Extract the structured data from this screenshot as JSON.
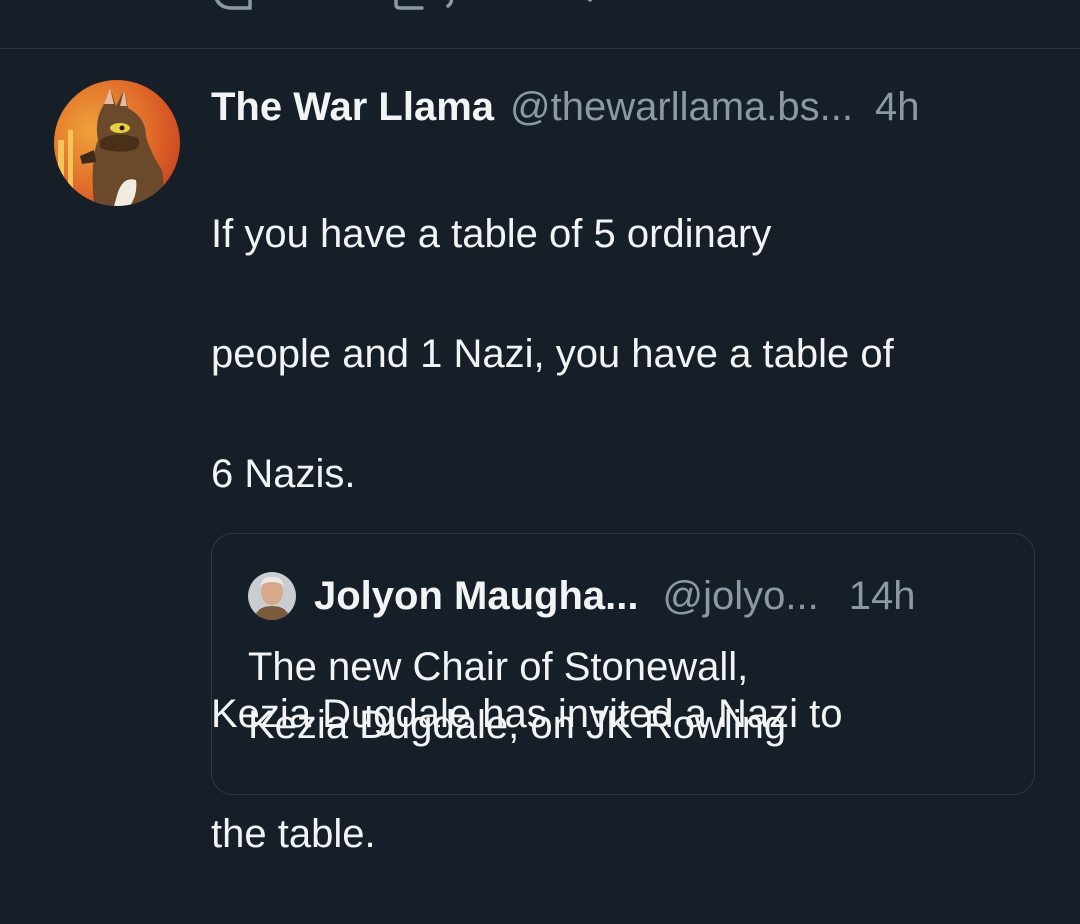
{
  "top_actions": {
    "reply_icon": "reply-icon",
    "repost_icon": "repost-icon",
    "like_icon": "heart-icon",
    "bookmark_icon": "bookmark-icon",
    "more_icon": "more-icon"
  },
  "post": {
    "author_name": "The War Llama",
    "author_handle": "@thewarllama.bs...",
    "time": "4h",
    "text_lines": [
      "If you have a table of 5 ordinary",
      "people and 1 Nazi, you have a table of",
      "6 Nazis.",
      "",
      "Kezia Dugdale has invited a Nazi to",
      "the table."
    ],
    "quote": {
      "author_name": "Jolyon Maugha...",
      "author_handle": "@jolyo...",
      "time": "14h",
      "text_lines": [
        "The new Chair of Stonewall,",
        "Kezia Dugdale, on JK Rowling"
      ]
    }
  },
  "colors": {
    "background": "#161e27",
    "text_primary": "#f1f3f5",
    "text_secondary": "#8b98a5",
    "border": "#2e3947"
  }
}
